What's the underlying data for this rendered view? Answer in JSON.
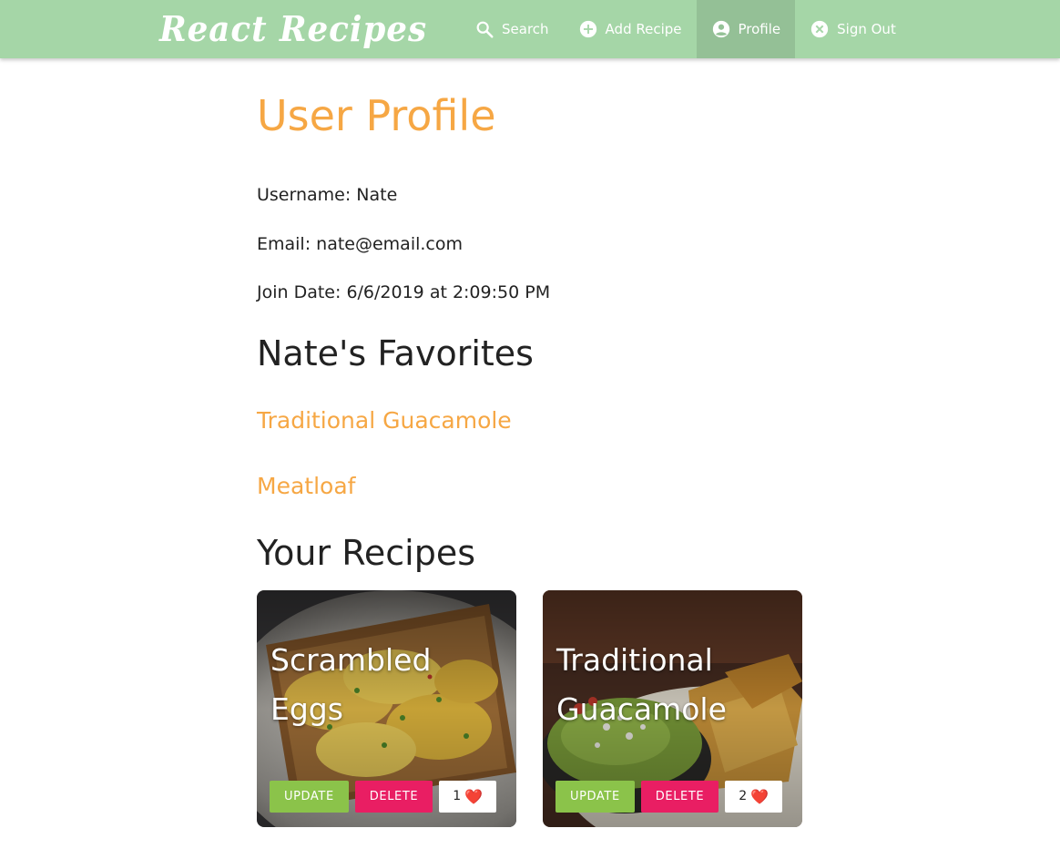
{
  "navbar": {
    "brand": "React Recipes",
    "links": [
      {
        "label": "Search",
        "icon": "search-icon"
      },
      {
        "label": "Add Recipe",
        "icon": "add-circle-icon"
      },
      {
        "label": "Profile",
        "icon": "account-circle-icon",
        "active": true
      },
      {
        "label": "Sign Out",
        "icon": "cancel-circle-icon"
      }
    ]
  },
  "profile": {
    "title": "User Profile",
    "username_line": "Username: Nate",
    "email_line": "Email: nate@email.com",
    "join_date_line": "Join Date: 6/6/2019 at 2:09:50 PM"
  },
  "favorites": {
    "title": "Nate's Favorites",
    "items": [
      "Traditional Guacamole",
      "Meatloaf"
    ]
  },
  "recipes": {
    "title": "Your Recipes",
    "items": [
      {
        "name": "Scrambled Eggs",
        "update_label": "Update",
        "delete_label": "Delete",
        "likes": "1",
        "heart": "❤️"
      },
      {
        "name": "Traditional Guacamole",
        "update_label": "Update",
        "delete_label": "Delete",
        "likes": "2",
        "heart": "❤️"
      }
    ]
  },
  "colors": {
    "navbar_bg": "#a5d6a7",
    "accent_orange": "#f6a744",
    "update_green": "#8bc34a",
    "delete_pink": "#e91e63"
  }
}
